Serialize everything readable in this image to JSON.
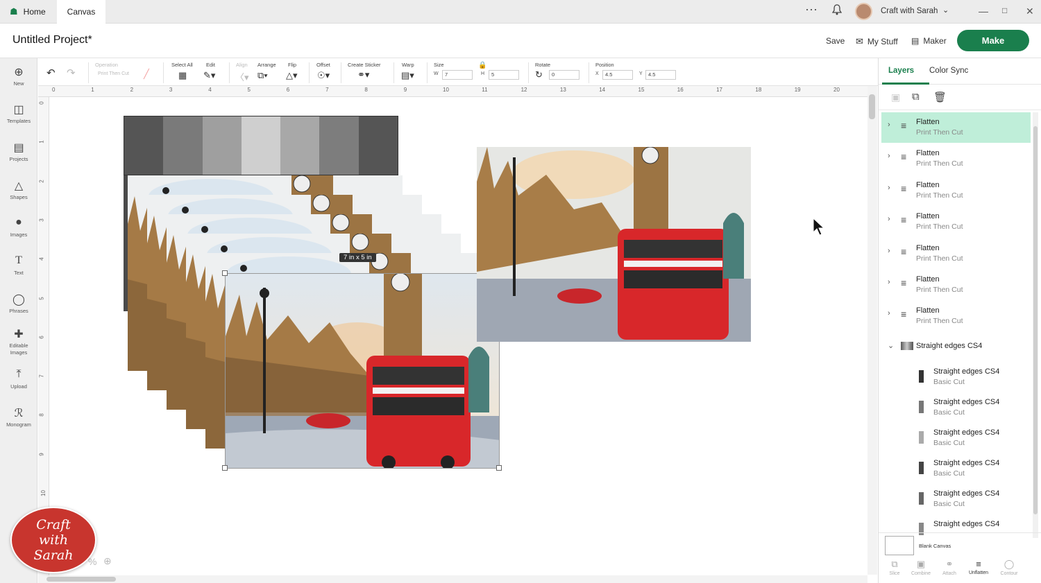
{
  "titlebar": {
    "tabs": [
      {
        "label": "Home"
      },
      {
        "label": "Canvas"
      }
    ],
    "user_name": "Craft with Sarah",
    "more_icon": "more-dots-icon",
    "bell_icon": "bell-icon"
  },
  "header": {
    "project_title": "Untitled Project*",
    "save_label": "Save",
    "mystuff_label": "My Stuff",
    "maker_label": "Maker",
    "make_label": "Make",
    "accent_color": "#1a7f4d"
  },
  "toolbar": {
    "operation_label": "Operation",
    "operation_value": "Print Then Cut",
    "select_all_label": "Select All",
    "edit_label": "Edit",
    "align_label": "Align",
    "arrange_label": "Arrange",
    "flip_label": "Flip",
    "offset_label": "Offset",
    "create_sticker_label": "Create Sticker",
    "warp_label": "Warp",
    "size_label": "Size",
    "w_label": "W",
    "w_value": "7",
    "h_label": "H",
    "h_value": "5",
    "rotate_label": "Rotate",
    "rotate_value": "0",
    "position_label": "Position",
    "x_label": "X",
    "x_value": "4.5",
    "y_label": "Y",
    "y_value": "4.5"
  },
  "sidebar": {
    "items": [
      {
        "label": "New",
        "icon": "plus-circle-icon"
      },
      {
        "label": "Templates",
        "icon": "shirt-icon"
      },
      {
        "label": "Projects",
        "icon": "projects-icon"
      },
      {
        "label": "Shapes",
        "icon": "shapes-icon"
      },
      {
        "label": "Images",
        "icon": "bulb-icon"
      },
      {
        "label": "Text",
        "icon": "text-icon"
      },
      {
        "label": "Phrases",
        "icon": "speech-icon"
      },
      {
        "label": "Editable Images",
        "icon": "editable-icon"
      },
      {
        "label": "Upload",
        "icon": "upload-icon"
      },
      {
        "label": "Monogram",
        "icon": "monogram-icon"
      }
    ]
  },
  "ruler": {
    "top": [
      "0",
      "1",
      "2",
      "3",
      "4",
      "5",
      "6",
      "7",
      "8",
      "9",
      "10",
      "11",
      "12",
      "13",
      "14",
      "15",
      "16",
      "17",
      "18",
      "19",
      "20"
    ],
    "left": [
      "0",
      "1",
      "2",
      "3",
      "4",
      "5",
      "6",
      "7",
      "8",
      "9",
      "10"
    ]
  },
  "canvas": {
    "size_tooltip": "7 in x 5 in",
    "zoom_fragment": "%",
    "palette": [
      "#555555",
      "#7a7a7a",
      "#9f9f9f",
      "#cfcfcf",
      "#a8a8a8",
      "#7d7d7d",
      "#555555"
    ]
  },
  "panel": {
    "tabs": [
      {
        "label": "Layers"
      },
      {
        "label": "Color Sync"
      }
    ],
    "layers": [
      {
        "title": "Flatten",
        "subtitle": "Print Then Cut",
        "selected": true
      },
      {
        "title": "Flatten",
        "subtitle": "Print Then Cut",
        "selected": false
      },
      {
        "title": "Flatten",
        "subtitle": "Print Then Cut",
        "selected": false
      },
      {
        "title": "Flatten",
        "subtitle": "Print Then Cut",
        "selected": false
      },
      {
        "title": "Flatten",
        "subtitle": "Print Then Cut",
        "selected": false
      },
      {
        "title": "Flatten",
        "subtitle": "Print Then Cut",
        "selected": false
      },
      {
        "title": "Flatten",
        "subtitle": "Print Then Cut",
        "selected": false
      }
    ],
    "group": {
      "title": "Straight edges CS4"
    },
    "sublayers": [
      {
        "title": "Straight edges CS4",
        "subtitle": "Basic Cut",
        "color": "#333333"
      },
      {
        "title": "Straight edges CS4",
        "subtitle": "Basic Cut",
        "color": "#777777"
      },
      {
        "title": "Straight edges CS4",
        "subtitle": "Basic Cut",
        "color": "#aaaaaa"
      },
      {
        "title": "Straight edges CS4",
        "subtitle": "Basic Cut",
        "color": "#444444"
      },
      {
        "title": "Straight edges CS4",
        "subtitle": "Basic Cut",
        "color": "#666666"
      },
      {
        "title": "Straight edges CS4",
        "subtitle": "",
        "color": "#888888"
      }
    ],
    "blank_canvas_label": "Blank Canvas",
    "bottom_actions": [
      {
        "label": "Slice"
      },
      {
        "label": "Combine"
      },
      {
        "label": "Attach"
      },
      {
        "label": "Unflatten"
      },
      {
        "label": "Contour"
      }
    ]
  },
  "logo": {
    "text": "Craft with Sarah"
  }
}
